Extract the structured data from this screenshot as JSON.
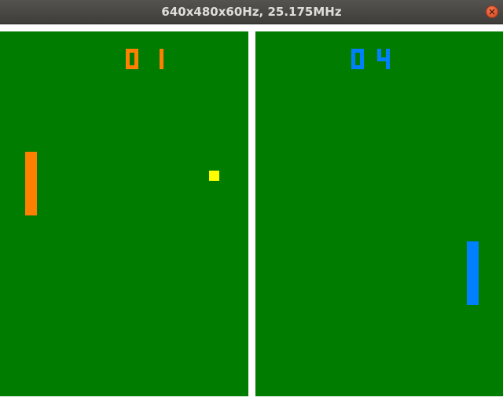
{
  "window": {
    "title": "640x480x60Hz, 25.175MHz"
  },
  "game": {
    "left_player": {
      "score_digits": [
        "0",
        "1"
      ],
      "color": "#ff7f00"
    },
    "right_player": {
      "score_digits": [
        "0",
        "4"
      ],
      "color": "#0080ff"
    },
    "ball_color": "#ffff00",
    "field_color": "#007c00",
    "divider_color": "#ffffff"
  }
}
